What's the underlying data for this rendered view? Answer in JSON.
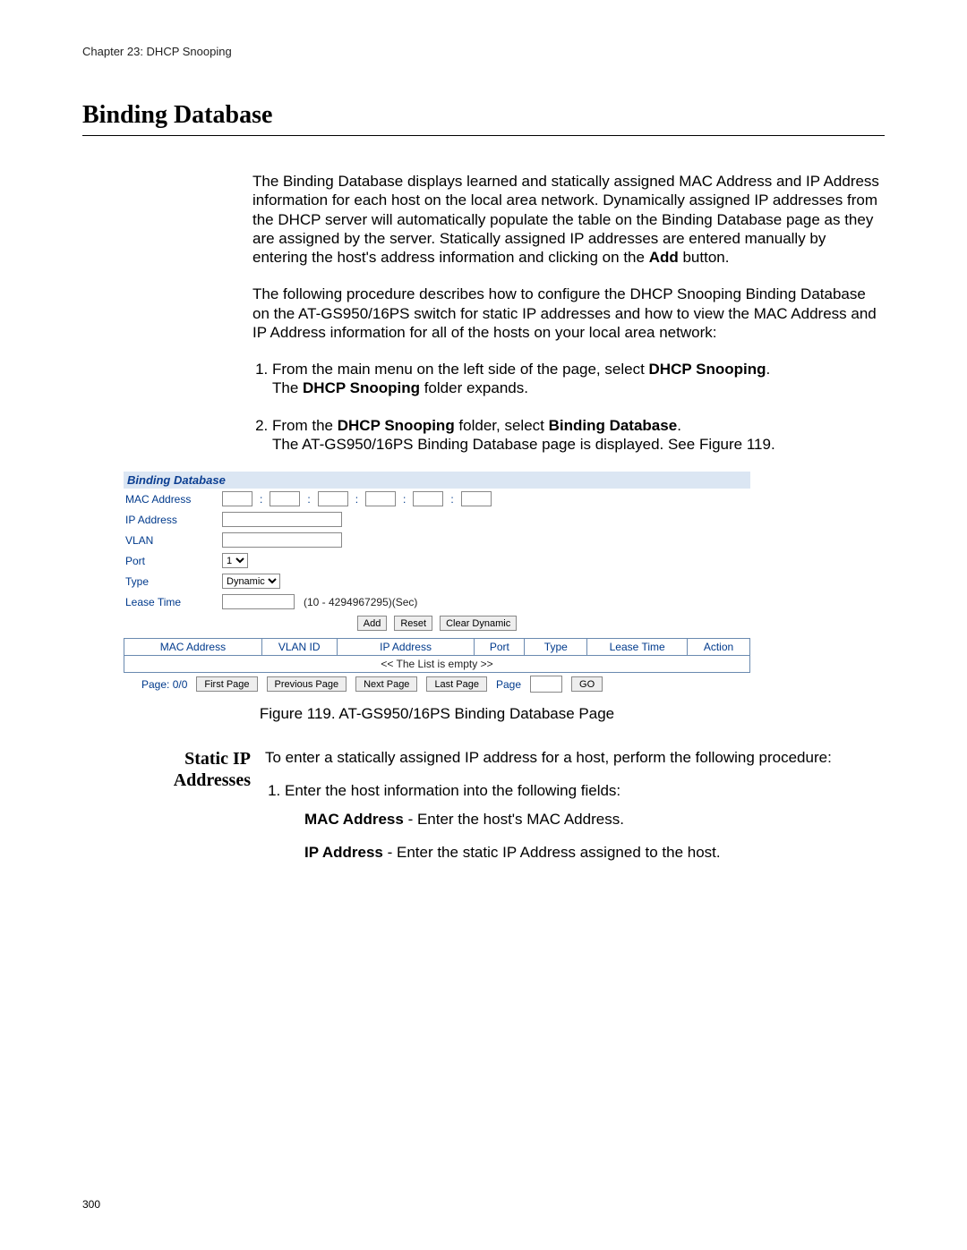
{
  "chapter": "Chapter 23: DHCP Snooping",
  "page_number": "300",
  "h1": "Binding Database",
  "intro_p1_a": "The Binding Database displays learned and statically assigned MAC Address and IP Address information for each host on the local area network. Dynamically assigned IP addresses from the DHCP server will automatically populate the table on the Binding Database page as they are assigned by the server. Statically assigned IP addresses are entered manually by entering the host's address information and clicking on the ",
  "intro_p1_b": "Add",
  "intro_p1_c": " button.",
  "intro_p2": "The following procedure describes how to configure the DHCP Snooping Binding Database on the AT-GS950/16PS switch for static IP addresses and how to view the MAC Address and IP Address information for all of the hosts on your local area network:",
  "step1_a": "From the main menu on the left side of the page, select ",
  "step1_b": "DHCP Snooping",
  "step1_c": ".",
  "step1_sub_a": "The ",
  "step1_sub_b": "DHCP Snooping",
  "step1_sub_c": " folder expands.",
  "step2_a": "From the ",
  "step2_b": "DHCP Snooping",
  "step2_c": " folder, select ",
  "step2_d": "Binding Database",
  "step2_e": ".",
  "step2_sub": "The AT-GS950/16PS Binding Database page is displayed. See Figure 119.",
  "ui": {
    "title": "Binding Database",
    "labels": {
      "mac": "MAC Address",
      "ip": "IP Address",
      "vlan": "VLAN",
      "port": "Port",
      "type": "Type",
      "lease": "Lease Time"
    },
    "port_value": "1",
    "type_value": "Dynamic",
    "lease_hint": "(10 - 4294967295)(Sec)",
    "buttons": {
      "add": "Add",
      "reset": "Reset",
      "clear": "Clear Dynamic"
    },
    "table": {
      "headers": [
        "MAC Address",
        "VLAN ID",
        "IP Address",
        "Port",
        "Type",
        "Lease Time",
        "Action"
      ],
      "empty": "<< The List is empty >>"
    },
    "pager": {
      "page_info": "Page: 0/0",
      "first": "First Page",
      "prev": "Previous Page",
      "next": "Next Page",
      "last": "Last Page",
      "page_label": "Page",
      "go": "GO"
    }
  },
  "figure_caption": "Figure 119. AT-GS950/16PS Binding Database Page",
  "side_heading_l1": "Static IP",
  "side_heading_l2": "Addresses",
  "static_intro": "To enter a statically assigned IP address for a host, perform the following procedure:",
  "static_step1": "Enter the host information into the following fields:",
  "field_mac_b": "MAC Address",
  "field_mac_rest": " - Enter the host's MAC Address.",
  "field_ip_b": "IP Address",
  "field_ip_rest": " - Enter the static IP Address assigned to the host."
}
